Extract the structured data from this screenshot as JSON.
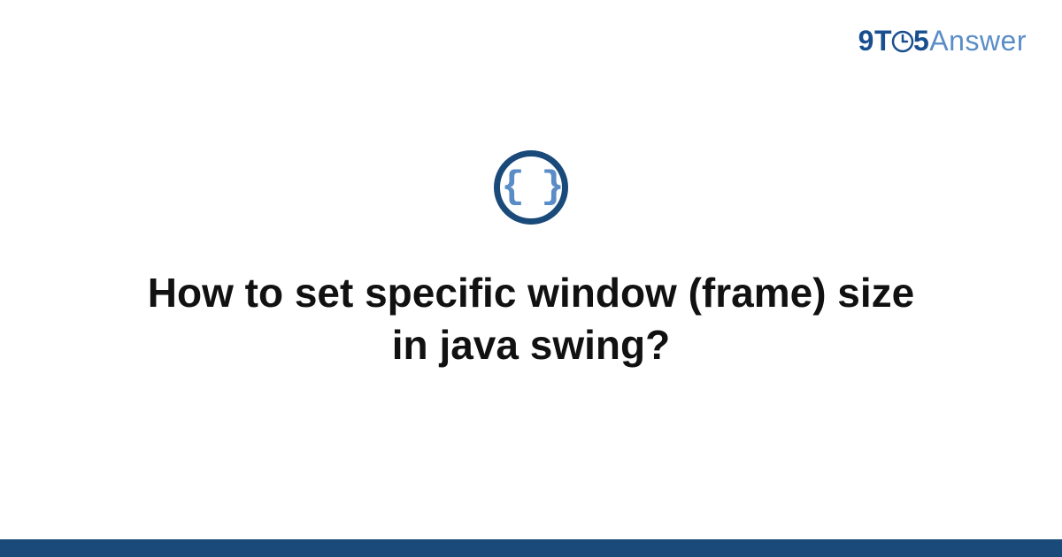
{
  "logo": {
    "part1": "9T",
    "part2": "5",
    "part3": "Answer"
  },
  "category": {
    "symbol": "{ }",
    "name": "code"
  },
  "question": {
    "title": "How to set specific window (frame) size in java swing?"
  },
  "colors": {
    "brand_primary": "#1a4a7a",
    "brand_secondary": "#5a8dc7",
    "logo_dark": "#1a4f8f"
  }
}
